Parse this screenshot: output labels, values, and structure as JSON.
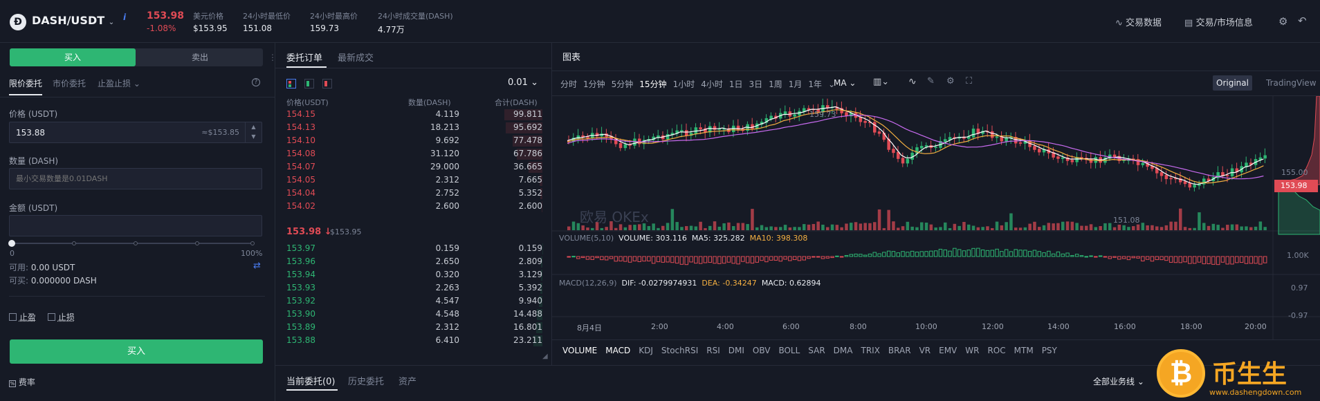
{
  "header": {
    "pair": "DASH/USDT",
    "last_price": "153.98",
    "change_pct": "-1.08%",
    "stats": [
      {
        "label": "美元价格",
        "value": "$153.95"
      },
      {
        "label": "24小时最低价",
        "value": "151.08"
      },
      {
        "label": "24小时最高价",
        "value": "159.73"
      },
      {
        "label": "24小时成交量(DASH)",
        "value": "4.77万"
      }
    ],
    "right_items": [
      "交易数据",
      "交易/市场信息"
    ]
  },
  "trade": {
    "buy_tab": "买入",
    "sell_tab": "卖出",
    "order_types": [
      "限价委托",
      "市价委托",
      "止盈止损"
    ],
    "price_label": "价格 (USDT)",
    "price_value": "153.88",
    "price_usd_hint": "≈$153.85",
    "amount_label": "数量 (DASH)",
    "amount_placeholder": "最小交易数量是0.01DASH",
    "total_label": "金额 (USDT)",
    "slider_min": "0",
    "slider_max": "100%",
    "available_label": "可用:",
    "available_value": "0.00 USDT",
    "can_buy_label": "可买:",
    "can_buy_value": "0.000000 DASH",
    "take_profit": "止盈",
    "stop_loss": "止损",
    "submit": "买入",
    "fee_rate": "费率"
  },
  "orderbook": {
    "tabs": [
      "委托订单",
      "最新成交"
    ],
    "precision": "0.01",
    "columns": [
      "价格(USDT)",
      "数量(DASH)",
      "合计(DASH)"
    ],
    "asks": [
      {
        "price": "154.15",
        "amount": "4.119",
        "total": "99.811"
      },
      {
        "price": "154.13",
        "amount": "18.213",
        "total": "95.692"
      },
      {
        "price": "154.10",
        "amount": "9.692",
        "total": "77.478"
      },
      {
        "price": "154.08",
        "amount": "31.120",
        "total": "67.786"
      },
      {
        "price": "154.07",
        "amount": "29.000",
        "total": "36.665"
      },
      {
        "price": "154.05",
        "amount": "2.312",
        "total": "7.665"
      },
      {
        "price": "154.04",
        "amount": "2.752",
        "total": "5.352"
      },
      {
        "price": "154.02",
        "amount": "2.600",
        "total": "2.600"
      }
    ],
    "mid_price": "153.98 ↓",
    "mid_usd": "$153.95",
    "bids": [
      {
        "price": "153.97",
        "amount": "0.159",
        "total": "0.159"
      },
      {
        "price": "153.96",
        "amount": "2.650",
        "total": "2.809"
      },
      {
        "price": "153.94",
        "amount": "0.320",
        "total": "3.129"
      },
      {
        "price": "153.93",
        "amount": "2.263",
        "total": "5.392"
      },
      {
        "price": "153.92",
        "amount": "4.547",
        "total": "9.940"
      },
      {
        "price": "153.90",
        "amount": "4.548",
        "total": "14.488"
      },
      {
        "price": "153.89",
        "amount": "2.312",
        "total": "16.801"
      },
      {
        "price": "153.88",
        "amount": "6.410",
        "total": "23.211"
      }
    ]
  },
  "chart": {
    "title": "图表",
    "intervals": [
      "分时",
      "1分钟",
      "5分钟",
      "15分钟",
      "1小时",
      "4小时",
      "1日",
      "3日",
      "1周",
      "1月",
      "1年"
    ],
    "active_interval": "15分钟",
    "ma_label": "MA",
    "view_original": "Original",
    "view_tradingview": "TradingView",
    "high_label": "159.73",
    "low_label": "151.08",
    "price_axis": [
      "155.00"
    ],
    "current_tag": "153.98",
    "watermark": "欧易 OKEx",
    "volume_legend": {
      "name": "VOLUME(5,10)",
      "volume": "VOLUME: 303.116",
      "ma5": "MA5: 325.282",
      "ma10": "MA10: 398.308"
    },
    "volume_axis": "1.00K",
    "macd_legend": {
      "name": "MACD(12,26,9)",
      "dif": "DIF: -0.0279974931",
      "dea": "DEA: -0.34247",
      "macd": "MACD: 0.62894"
    },
    "macd_axis": [
      "0.97",
      "-0.97"
    ],
    "time_axis": [
      "8月4日",
      "2:00",
      "4:00",
      "6:00",
      "8:00",
      "10:00",
      "12:00",
      "14:00",
      "16:00",
      "18:00",
      "20:00"
    ],
    "indicators": [
      "VOLUME",
      "MACD",
      "KDJ",
      "StochRSI",
      "RSI",
      "DMI",
      "OBV",
      "BOLL",
      "SAR",
      "DMA",
      "TRIX",
      "BRAR",
      "VR",
      "EMV",
      "WR",
      "ROC",
      "MTM",
      "PSY"
    ]
  },
  "bottom": {
    "tabs": [
      "当前委托(0)",
      "历史委托",
      "资产"
    ],
    "filter": "全部业务线"
  },
  "branding": {
    "text": "币生生",
    "site": "www.dashengdown.com"
  },
  "colors": {
    "up": "#2eb673",
    "down": "#e04b55",
    "ma5": "#ffffff",
    "ma10": "#f5b041",
    "ma20": "#c86bf0"
  }
}
